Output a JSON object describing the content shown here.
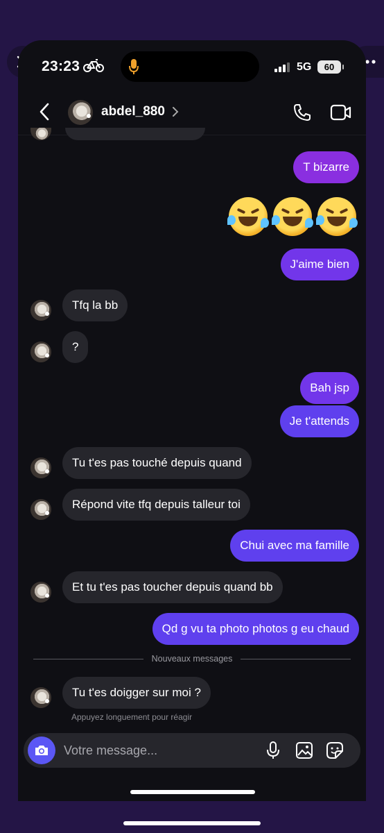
{
  "status_bar": {
    "time": "23:23",
    "network": "5G",
    "battery": "60"
  },
  "header": {
    "username": "abdel_880"
  },
  "messages": {
    "m1": "T bizarre",
    "m3": "J'aime bien",
    "m4": "Tfq la bb",
    "m5": "?",
    "m6": "Bah jsp",
    "m7": "Je t'attends",
    "m8": "Tu t'es pas touché depuis quand",
    "m9": "Répond vite tfq depuis talleur toi",
    "m10": "Chui avec ma famille",
    "m11": "Et tu t'es pas toucher depuis quand bb",
    "m12": "Qd g vu ta photo photos g eu chaud",
    "m13": "Tu t'es doigger sur moi ?"
  },
  "emoji_message": {
    "icons": [
      "rolling-on-floor-laughing-emoji",
      "rolling-on-floor-laughing-emoji",
      "rolling-on-floor-laughing-emoji"
    ]
  },
  "divider_label": "Nouveaux messages",
  "reaction_hint": "Appuyez longuement pour réagir",
  "composer": {
    "placeholder": "Votre message..."
  },
  "colors": {
    "outgoing_bubble": "#7b34e8",
    "incoming_bubble": "#26262c",
    "camera_button": "#5b57f5",
    "background": "#0f0f14",
    "frame": "#241546"
  }
}
